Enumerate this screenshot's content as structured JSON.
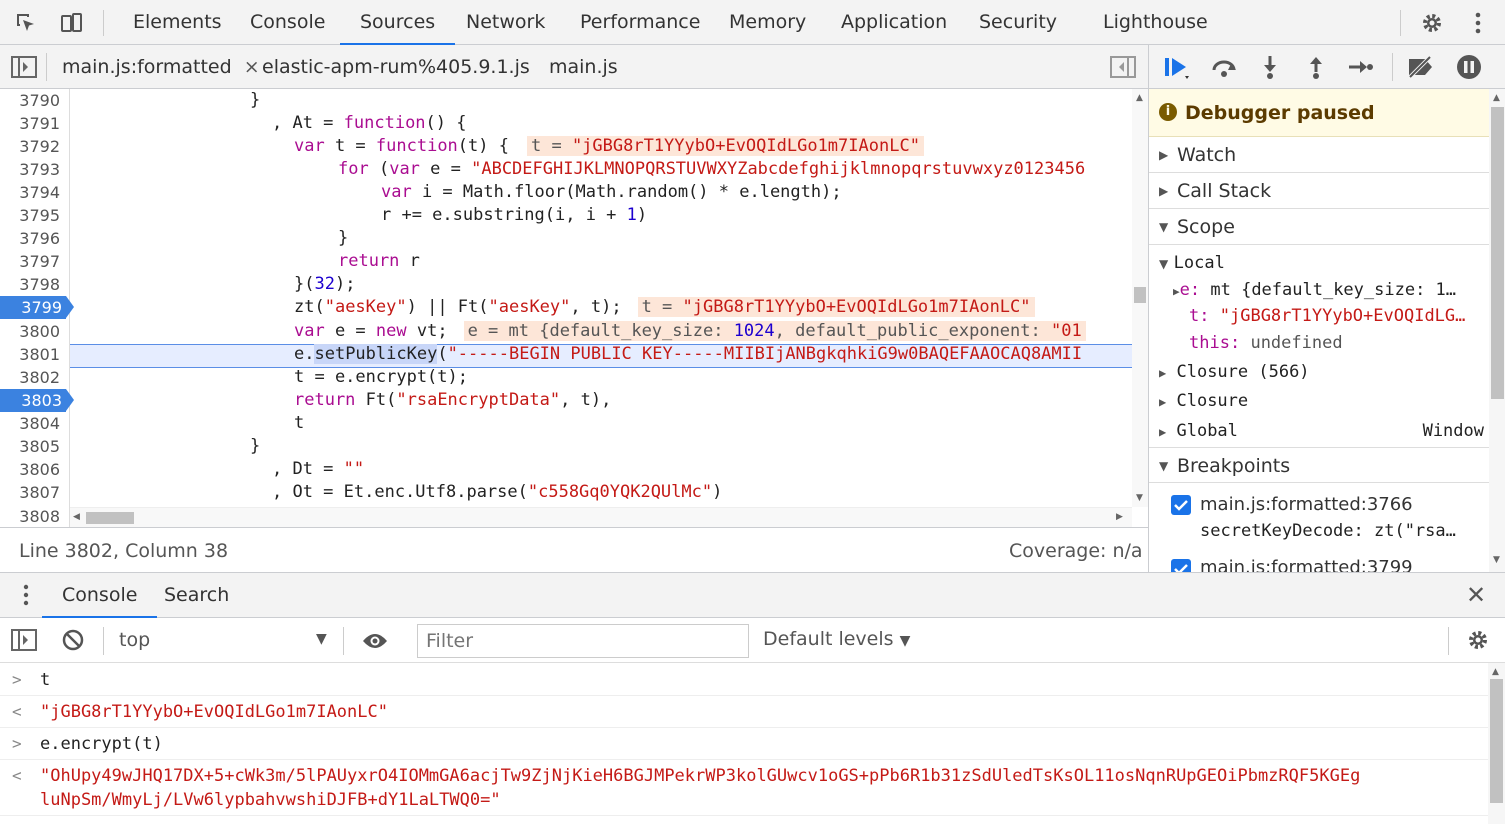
{
  "main_tabs": [
    {
      "label": "Elements"
    },
    {
      "label": "Console"
    },
    {
      "label": "Sources",
      "active": true
    },
    {
      "label": "Network"
    },
    {
      "label": "Performance"
    },
    {
      "label": "Memory"
    },
    {
      "label": "Application"
    },
    {
      "label": "Security"
    },
    {
      "label": "Lighthouse"
    }
  ],
  "file_tabs": [
    {
      "label": "main.js:formatted",
      "close": "×",
      "active": true
    },
    {
      "label": "elastic-apm-rum%405.9.1.js"
    },
    {
      "label": "main.js"
    }
  ],
  "gutter": [
    "3790",
    "3791",
    "3792",
    "3793",
    "3794",
    "3795",
    "3796",
    "3797",
    "3798",
    "3799",
    "3800",
    "3801",
    "3802",
    "3803",
    "3804",
    "3805",
    "3806",
    "3807",
    "3808"
  ],
  "code": {
    "l3790": "}",
    "l3791a": ", At = ",
    "l3791b": "function",
    "l3791c": "() {",
    "l3792a": "var",
    "l3792b": " t = ",
    "l3792c": "function",
    "l3792d": "(t) {",
    "l3792_inline_k": "t = ",
    "l3792_inline_v": "\"jGBG8rT1YYybO+EvOQIdLGo1m7IAonLC\"",
    "l3793a": "for",
    "l3793b": " (",
    "l3793c": "var",
    "l3793d": " e = ",
    "l3793e": "\"ABCDEFGHIJKLMNOPQRSTUVWXYZabcdefghijklmnopqrstuvwxyz0123456",
    "l3794a": "var",
    "l3794b": " i = Math.floor(Math.random() * e.length);",
    "l3795a": "r += e.substring(i, i + ",
    "l3795b": "1",
    "l3795c": ")",
    "l3796": "}",
    "l3797a": "return",
    "l3797b": " r",
    "l3798a": "}(",
    "l3798b": "32",
    "l3798c": ");",
    "l3799a": "zt(",
    "l3799b": "\"aesKey\"",
    "l3799c": ") || Ft(",
    "l3799d": "\"aesKey\"",
    "l3799e": ", t);",
    "l3799_inline_k": "t = ",
    "l3799_inline_v": "\"jGBG8rT1YYybO+EvOQIdLGo1m7IAonLC\"",
    "l3800a": "var",
    "l3800b": " e = ",
    "l3800c": "new",
    "l3800d": " vt;",
    "l3800_inline_k": "e = mt {default_key_size: ",
    "l3800_inline_n": "1024",
    "l3800_inline_r": ", default_public_exponent: ",
    "l3800_inline_s": "\"01",
    "l3801a": "e.",
    "l3801b": "setPublicKey",
    "l3801c": "(",
    "l3801d": "\"-----BEGIN PUBLIC KEY-----MIIBIjANBgkqhkiG9w0BAQEFAAOCAQ8AMII",
    "l3802": "t = e.encrypt(t);",
    "l3803a": "return",
    "l3803b": " Ft(",
    "l3803c": "\"rsaEncryptData\"",
    "l3803d": ", t),",
    "l3804": "t",
    "l3805": "}",
    "l3806a": ", Dt = ",
    "l3806b": "\"\"",
    "l3807a": ", Ot = Et.enc.Utf8.parse(",
    "l3807b": "\"c558Gq0YQK2QUlMc\"",
    "l3807c": ")"
  },
  "status": {
    "position": "Line 3802, Column 38",
    "coverage": "Coverage: n/a"
  },
  "debugger": {
    "paused_label": "Debugger paused",
    "sections": {
      "watch": "Watch",
      "callstack": "Call Stack",
      "scope": "Scope",
      "local": "Local",
      "breakpoints": "Breakpoints"
    },
    "scope_local": [
      {
        "key": "e",
        "value": "mt {default_key_size: 1…"
      },
      {
        "key": "t",
        "value": "\"jGBG8rT1YYybO+EvOQIdLG…"
      },
      {
        "key": "this",
        "value": "undefined"
      }
    ],
    "closures": [
      "Closure (566)",
      "Closure"
    ],
    "global": {
      "label": "Global",
      "value": "Window"
    },
    "breakpoints": [
      {
        "file": "main.js:formatted:3766",
        "code": "secretKeyDecode: zt(\"rsa…",
        "checked": true
      },
      {
        "file": "main.js:formatted:3799",
        "checked": true
      }
    ]
  },
  "drawer": {
    "tabs": [
      {
        "label": "Console",
        "active": true
      },
      {
        "label": "Search"
      }
    ],
    "context": "top",
    "filter_placeholder": "Filter",
    "levels": "Default levels",
    "lines": [
      {
        "prompt": ">",
        "text": "t",
        "type": "input"
      },
      {
        "prompt": "<",
        "text": "\"jGBG8rT1YYybO+EvOQIdLGo1m7IAonLC\"",
        "type": "result"
      },
      {
        "prompt": ">",
        "text": "e.encrypt(t)",
        "type": "input"
      },
      {
        "prompt": "<",
        "text": "\"OhUpy49wJHQ17DX+5+cWk3m/5lPAUyxrO4IOMmGA6acjTw9ZjNjKieH6BGJMPekrWP3kolGUwcv1oGS+pPb6R1b31zSdUledTsKsOL11osNqnRUpGEOiPbmzRQF5KGEg\nluNpSm/WmyLj/LVw6lypbahvwshiDJFB+dY1LaLTWQ0=\"",
        "type": "result"
      }
    ]
  },
  "colors": {
    "accent": "#1a73e8",
    "breakpoint": "#3b82e0",
    "paused_bg": "#fffbe5",
    "string": "#c41a16",
    "keyword": "#aa0d91"
  }
}
